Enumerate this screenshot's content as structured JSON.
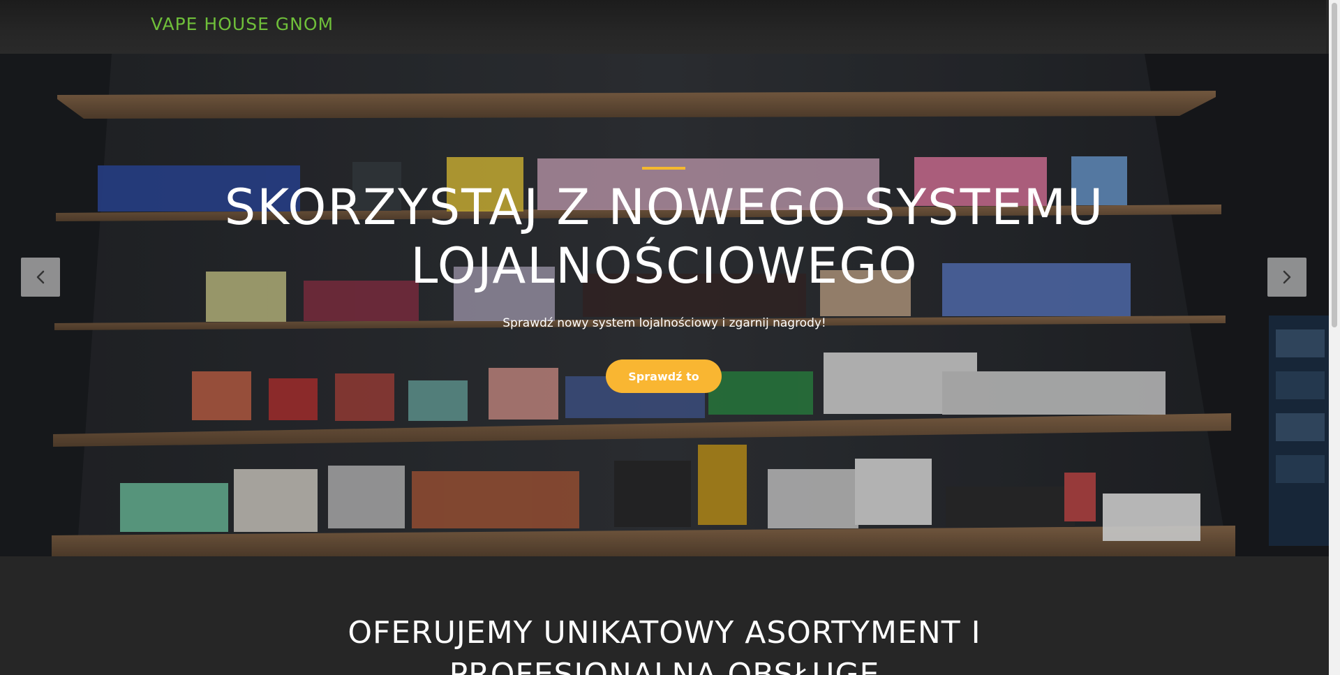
{
  "header": {
    "brand": "VAPE HOUSE GNOM"
  },
  "hero": {
    "title": "SKORZYSTAJ Z NOWEGO SYSTEMU LOJALNOŚCIOWEGO",
    "subtitle": "Sprawdź nowy system lojalnościowy i zgarnij nagrody!",
    "cta_label": "Sprawdź to",
    "prev_icon": "chevron-left-icon",
    "next_icon": "chevron-right-icon"
  },
  "offer": {
    "title": "OFERUJEMY UNIKATOWY ASORTYMENT I PROFESJONALNĄ OBSŁUGĘ"
  },
  "colors": {
    "brand": "#6fbf3a",
    "accent": "#f5b82e",
    "cta": "#f9b632",
    "background": "#262626"
  }
}
